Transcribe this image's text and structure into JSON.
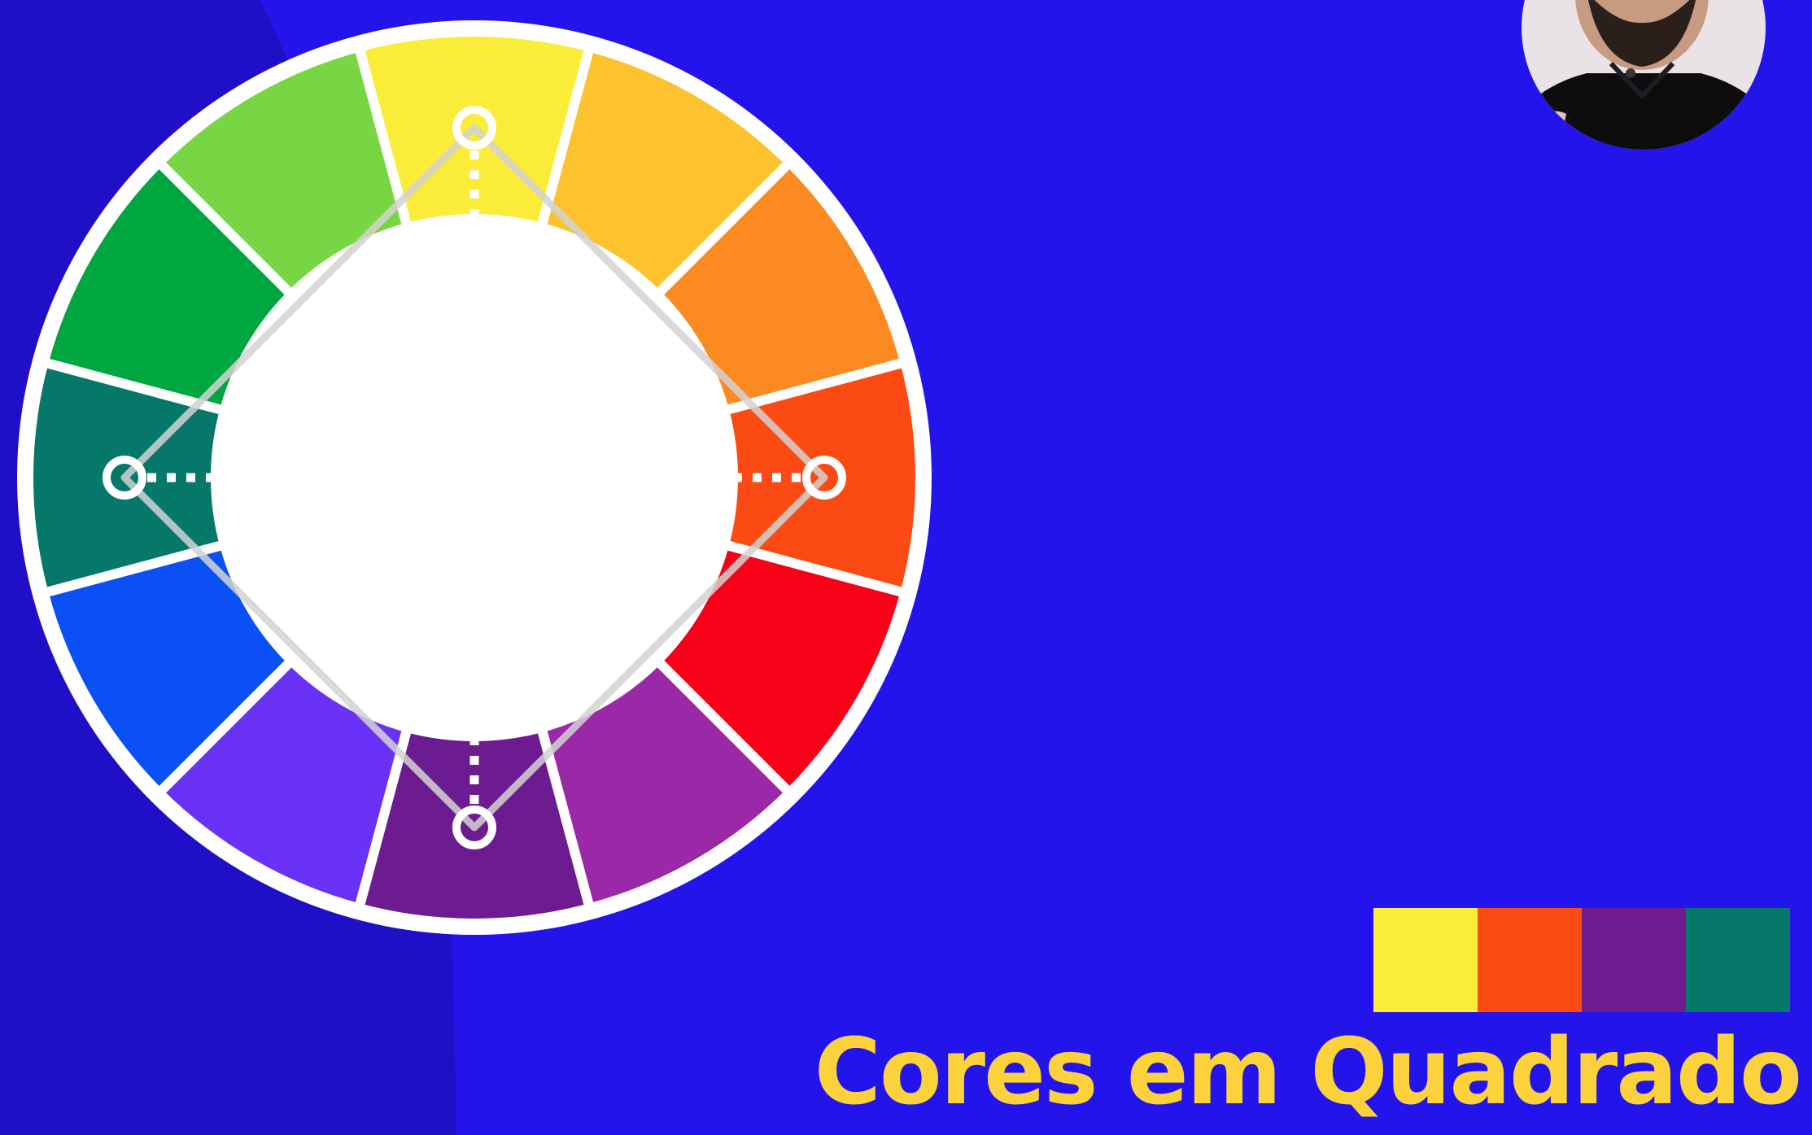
{
  "title": "Cores em Quadrado",
  "colors": {
    "background": "#2314ec",
    "background_shade": "#1f0fc6",
    "title": "#fbd13c",
    "outline": "#ffffff"
  },
  "wheel_segments": [
    {
      "name": "yellow",
      "color": "#faec38"
    },
    {
      "name": "yellow-orange",
      "color": "#fcc32f"
    },
    {
      "name": "orange",
      "color": "#fc8a22"
    },
    {
      "name": "red-orange",
      "color": "#fc4a14"
    },
    {
      "name": "red",
      "color": "#f80018"
    },
    {
      "name": "red-violet",
      "color": "#9b28a6"
    },
    {
      "name": "violet",
      "color": "#6d1b91"
    },
    {
      "name": "blue-violet",
      "color": "#6a31f7"
    },
    {
      "name": "blue",
      "color": "#0a50f4"
    },
    {
      "name": "blue-green",
      "color": "#05786a"
    },
    {
      "name": "green",
      "color": "#00a63f"
    },
    {
      "name": "yellow-green",
      "color": "#78d645"
    }
  ],
  "scheme": {
    "selected_segments": [
      0,
      3,
      6,
      9
    ],
    "swatches": [
      "#faec38",
      "#fc4a14",
      "#6d1b91",
      "#05786a"
    ]
  },
  "presenter_avatar": {
    "visible": true
  }
}
